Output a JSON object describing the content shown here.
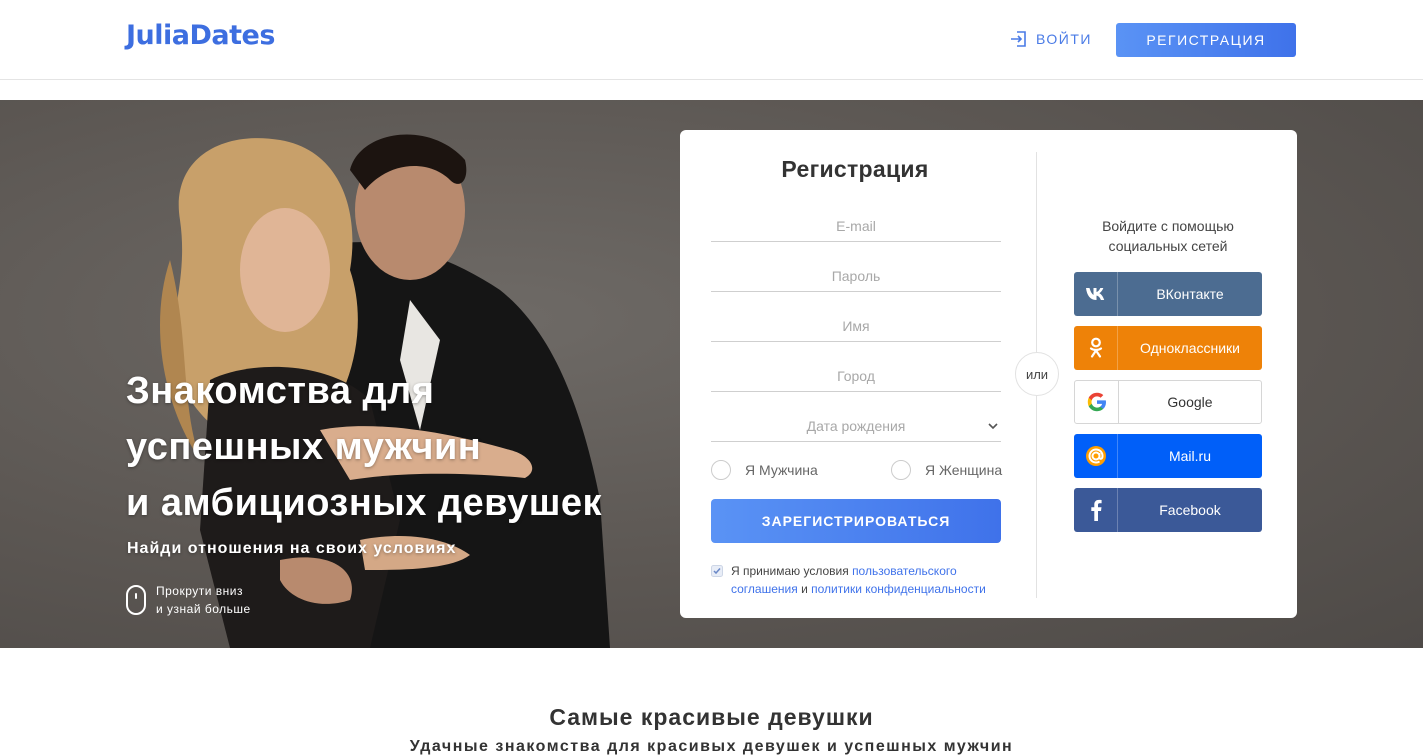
{
  "header": {
    "logo": "JuliaDates",
    "login_label": "ВОЙТИ",
    "register_label": "РЕГИСТРАЦИЯ"
  },
  "hero": {
    "title_lines": [
      "Знакомства для",
      "успешных мужчин",
      "и амбициозных девушек"
    ],
    "subtitle": "Найди отношения на своих условиях",
    "scroll_line1": "Прокрути вниз",
    "scroll_line2": "и узнай больше"
  },
  "form": {
    "title": "Регистрация",
    "email_placeholder": "E-mail",
    "password_placeholder": "Пароль",
    "name_placeholder": "Имя",
    "city_placeholder": "Город",
    "birthdate_placeholder": "Дата рождения",
    "gender_male": "Я Мужчина",
    "gender_female": "Я Женщина",
    "submit_label": "ЗАРЕГИСТРИРОВАТЬСЯ",
    "terms_prefix": "Я принимаю условия",
    "terms_link1": "пользовательского соглашения",
    "terms_and": "и",
    "terms_link2": "политики конфиденциальности",
    "or_label": "или"
  },
  "social": {
    "title": "Войдите с помощью социальных сетей",
    "buttons": [
      {
        "label": "ВКонтакте",
        "icon": "vk-icon"
      },
      {
        "label": "Одноклассники",
        "icon": "odnoklassniki-icon"
      },
      {
        "label": "Google",
        "icon": "google-icon"
      },
      {
        "label": "Mail.ru",
        "icon": "mailru-icon"
      },
      {
        "label": "Facebook",
        "icon": "facebook-icon"
      }
    ]
  },
  "section": {
    "title": "Самые красивые девушки",
    "subtitle": "Удачные знакомства для красивых девушек и успешных мужчин"
  },
  "colors": {
    "accent": "#3f72ea",
    "vk": "#4c6c91",
    "ok": "#ee8208",
    "mailru": "#005ff9",
    "facebook": "#3b5998"
  }
}
